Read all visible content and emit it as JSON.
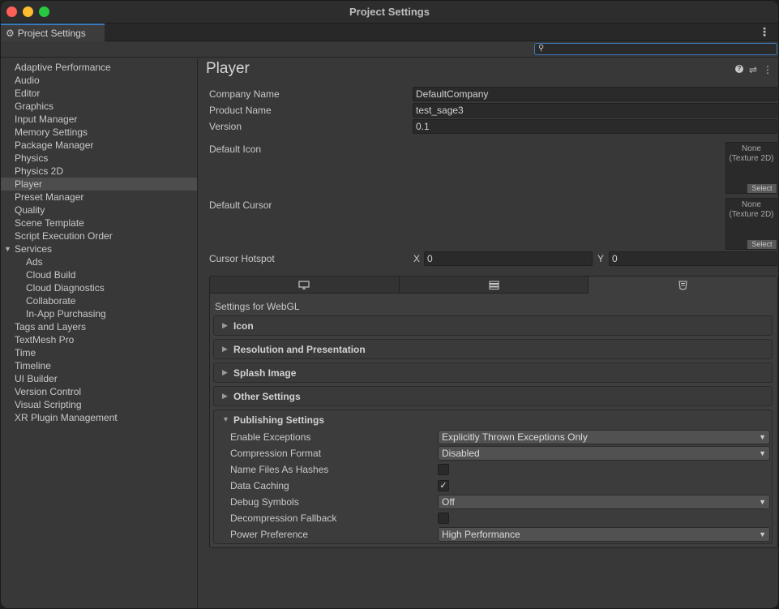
{
  "window": {
    "title": "Project Settings"
  },
  "tab": {
    "label": "Project Settings"
  },
  "search": {
    "value": "",
    "placeholder": ""
  },
  "sidebar": {
    "items": [
      {
        "label": "Adaptive Performance"
      },
      {
        "label": "Audio"
      },
      {
        "label": "Editor"
      },
      {
        "label": "Graphics"
      },
      {
        "label": "Input Manager"
      },
      {
        "label": "Memory Settings"
      },
      {
        "label": "Package Manager"
      },
      {
        "label": "Physics"
      },
      {
        "label": "Physics 2D"
      },
      {
        "label": "Player"
      },
      {
        "label": "Preset Manager"
      },
      {
        "label": "Quality"
      },
      {
        "label": "Scene Template"
      },
      {
        "label": "Script Execution Order"
      },
      {
        "label": "Services"
      },
      {
        "label": "Ads"
      },
      {
        "label": "Cloud Build"
      },
      {
        "label": "Cloud Diagnostics"
      },
      {
        "label": "Collaborate"
      },
      {
        "label": "In-App Purchasing"
      },
      {
        "label": "Tags and Layers"
      },
      {
        "label": "TextMesh Pro"
      },
      {
        "label": "Time"
      },
      {
        "label": "Timeline"
      },
      {
        "label": "UI Builder"
      },
      {
        "label": "Version Control"
      },
      {
        "label": "Visual Scripting"
      },
      {
        "label": "XR Plugin Management"
      }
    ]
  },
  "player": {
    "title": "Player",
    "company_name_label": "Company Name",
    "company_name_value": "DefaultCompany",
    "product_name_label": "Product Name",
    "product_name_value": "test_sage3",
    "version_label": "Version",
    "version_value": "0.1",
    "default_icon_label": "Default Icon",
    "default_cursor_label": "Default Cursor",
    "texture_none": "None",
    "texture_type": "(Texture 2D)",
    "select_label": "Select",
    "cursor_hotspot_label": "Cursor Hotspot",
    "x_label": "X",
    "x_value": "0",
    "y_label": "Y",
    "y_value": "0"
  },
  "platform": {
    "settings_for": "Settings for WebGL",
    "sections": {
      "icon": "Icon",
      "resolution": "Resolution and Presentation",
      "splash": "Splash Image",
      "other": "Other Settings",
      "publishing": "Publishing Settings"
    },
    "publishing": {
      "enable_exceptions_label": "Enable Exceptions",
      "enable_exceptions_value": "Explicitly Thrown Exceptions Only",
      "compression_label": "Compression Format",
      "compression_value": "Disabled",
      "name_files_label": "Name Files As Hashes",
      "name_files_checked": false,
      "data_caching_label": "Data Caching",
      "data_caching_checked": true,
      "debug_symbols_label": "Debug Symbols",
      "debug_symbols_value": "Off",
      "decompression_label": "Decompression Fallback",
      "decompression_checked": false,
      "power_label": "Power Preference",
      "power_value": "High Performance"
    }
  }
}
